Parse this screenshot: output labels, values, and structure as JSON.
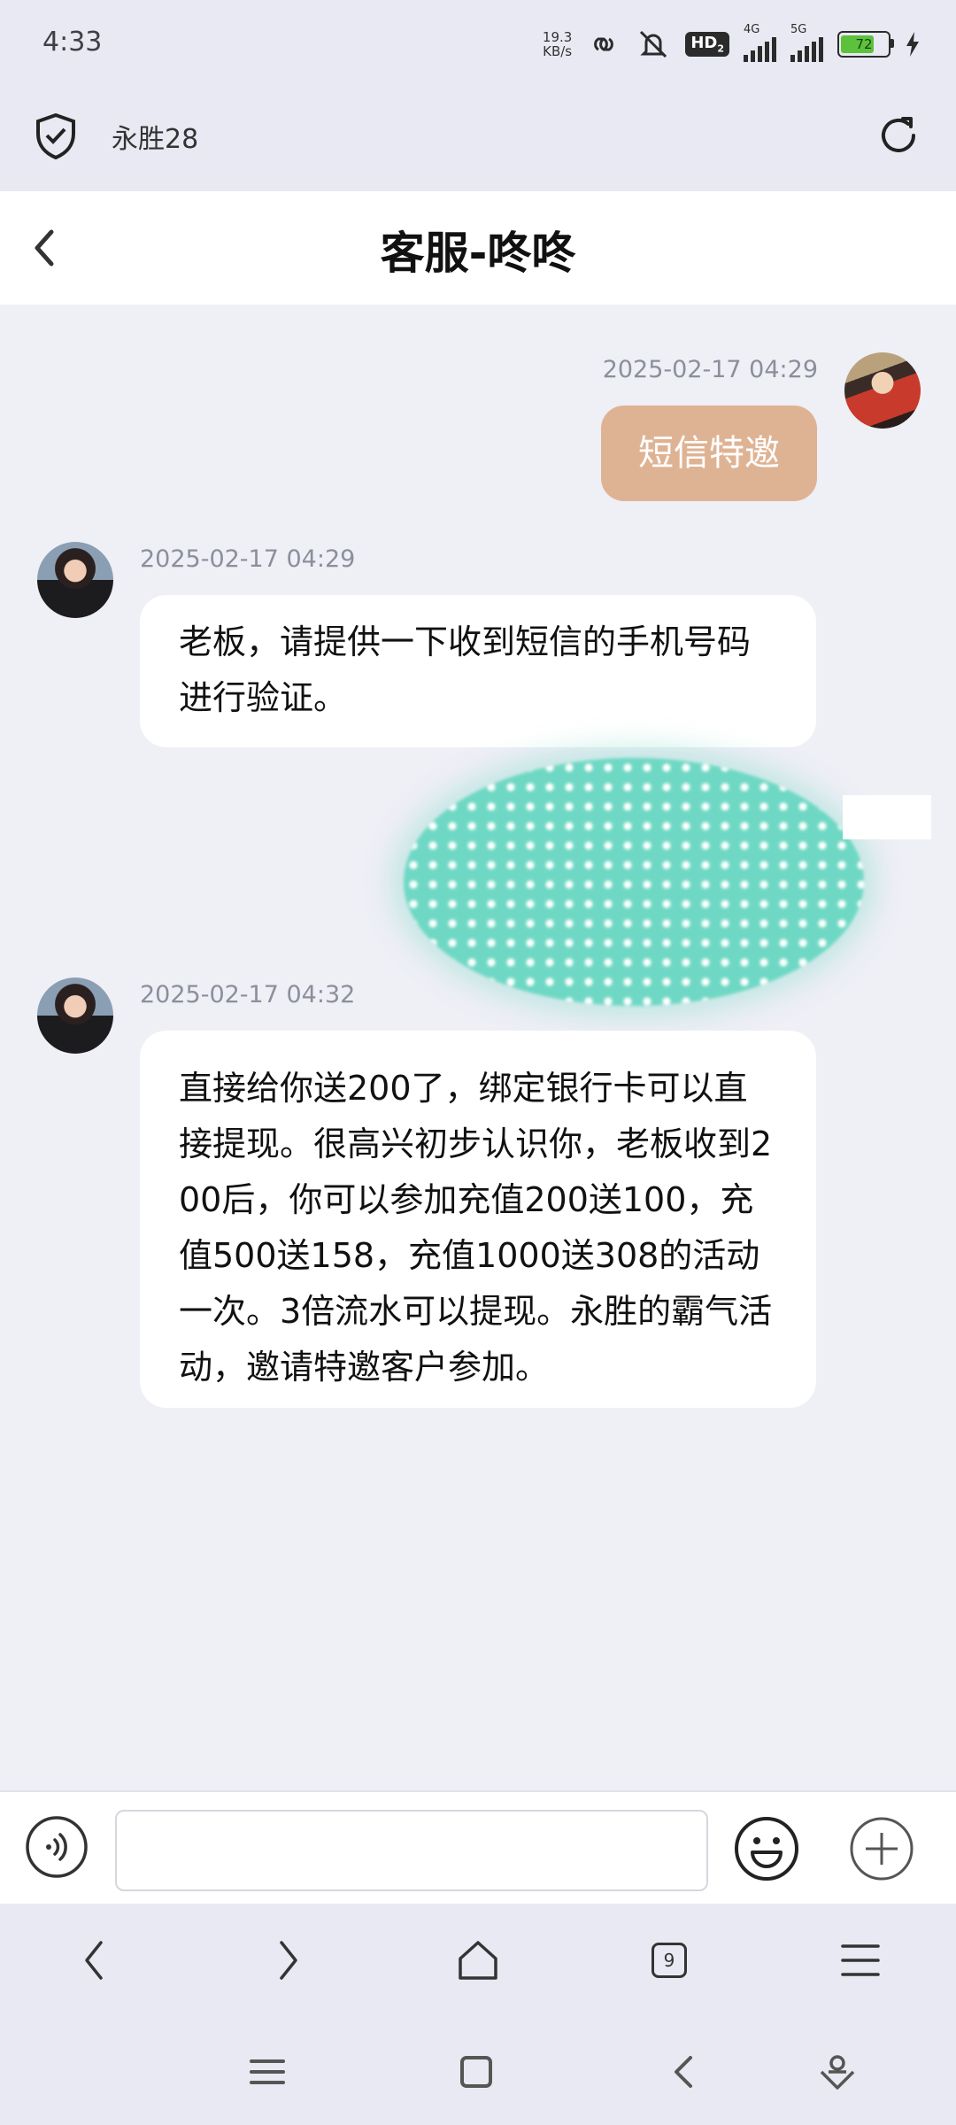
{
  "status_bar": {
    "time": "4:33",
    "net_speed_value": "19.3",
    "net_speed_unit": "KB/s",
    "hd_label": "HD",
    "hd_sub": "2",
    "sig1_label": "4G",
    "sig2_label": "5G",
    "battery_level": "72",
    "icons": [
      "link-icon",
      "mute-icon",
      "hd-icon",
      "signal-icon",
      "signal-icon",
      "battery-icon",
      "charging-icon"
    ]
  },
  "browser": {
    "site_title": "永胜28",
    "icons": [
      "shield-check-icon",
      "refresh-icon"
    ]
  },
  "chat": {
    "title": "客服-咚咚",
    "messages": [
      {
        "side": "out",
        "time": "2025-02-17 04:29",
        "text": "短信特邀"
      },
      {
        "side": "in",
        "time": "2025-02-17 04:29",
        "text": "老板，请提供一下收到短信的手机号码进行验证。"
      },
      {
        "side": "in",
        "time": "2025-02-17 04:32",
        "text": "直接给你送200了，绑定银行卡可以直接提现。很高兴初步认识你，老板收到200后，你可以参加充值200送100，充值500送158，充值1000送308的活动一次。3倍流水可以提现。永胜的霸气活动，邀请特邀客户参加。"
      }
    ]
  },
  "input_bar": {
    "value": "",
    "placeholder": ""
  },
  "browser_nav": {
    "tabs_count": "9"
  },
  "colors": {
    "outgoing_bubble": "#deb394",
    "incoming_bubble": "#ffffff",
    "chat_background": "#efeff6",
    "blob": "#6fd8c4"
  }
}
